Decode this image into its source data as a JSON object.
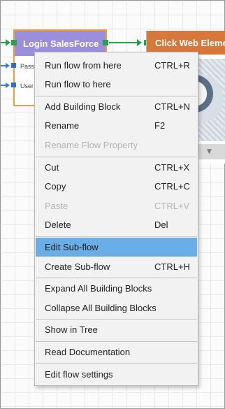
{
  "canvas": {
    "blocks": {
      "login": {
        "title": "Login SalesForce",
        "params": [
          "Pass",
          "User"
        ]
      },
      "click": {
        "title": "Click Web Element"
      }
    }
  },
  "context_menu": {
    "items": [
      {
        "label": "Run flow from here",
        "shortcut": "CTRL+R"
      },
      {
        "label": "Run flow to here",
        "shortcut": ""
      },
      {
        "label": "Add Building Block",
        "shortcut": "CTRL+N"
      },
      {
        "label": "Rename",
        "shortcut": "F2"
      },
      {
        "label": "Rename Flow Property",
        "shortcut": "",
        "disabled": true
      },
      {
        "label": "Cut",
        "shortcut": "CTRL+X"
      },
      {
        "label": "Copy",
        "shortcut": "CTRL+C"
      },
      {
        "label": "Paste",
        "shortcut": "CTRL+V",
        "disabled": true
      },
      {
        "label": "Delete",
        "shortcut": "Del"
      },
      {
        "label": "Edit Sub-flow",
        "shortcut": "",
        "highlighted": true
      },
      {
        "label": "Create Sub-flow",
        "shortcut": "CTRL+H"
      },
      {
        "label": "Expand All Building Blocks",
        "shortcut": ""
      },
      {
        "label": "Collapse All Building Blocks",
        "shortcut": ""
      },
      {
        "label": "Show in Tree",
        "shortcut": ""
      },
      {
        "label": "Read Documentation",
        "shortcut": ""
      },
      {
        "label": "Edit flow settings",
        "shortcut": ""
      }
    ]
  },
  "colors": {
    "login_header": "#9b8fdb",
    "login_border": "#f0a030",
    "click_header": "#d8773a",
    "connector_green": "#24a050",
    "connector_blue": "#3b7bd1",
    "menu_highlight": "#6aaee8",
    "menu_background": "#f2f2f2"
  },
  "icons": {
    "flow_arrow": "arrow-right-icon",
    "globe": "globe-icon",
    "dropdown": "chevron-down-icon"
  }
}
